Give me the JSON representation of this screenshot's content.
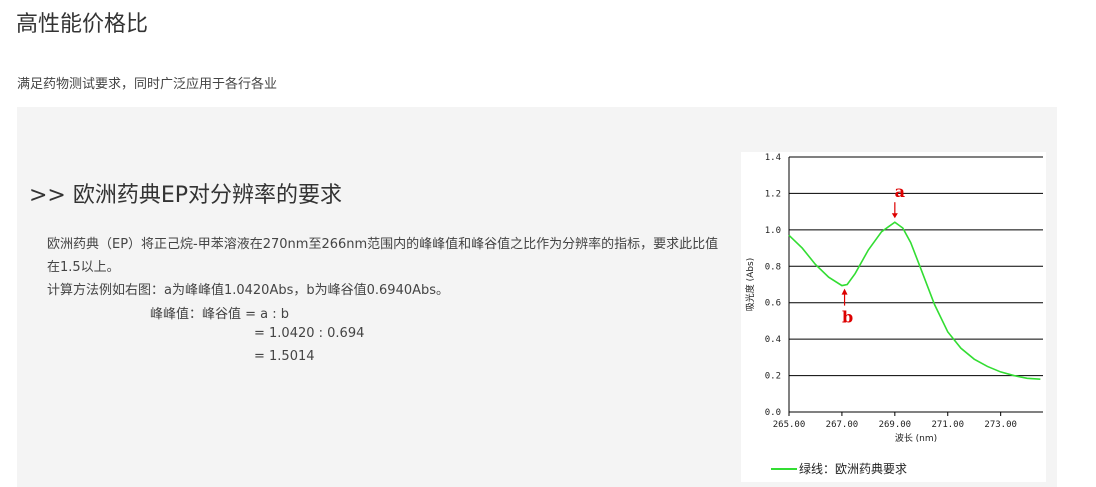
{
  "header": {
    "title": "高性能价格比",
    "subtitle": "满足药物测试要求，同时广泛应用于各行各业"
  },
  "section": {
    "title": ">> 欧洲药典EP对分辨率的要求",
    "para1": "欧洲药典（EP）将正己烷-甲苯溶液在270nm至266nm范围内的峰峰值和峰谷值之比作为分辨率的指标，要求此比值在1.5以上。",
    "para2": "计算方法例如右图：a为峰峰值1.0420Abs，b为峰谷值0.6940Abs。",
    "formula1": "峰峰值：峰谷值 = a : b",
    "formula2": "= 1.0420 : 0.694",
    "formula3": "= 1.5014"
  },
  "chart_data": {
    "type": "line",
    "xlabel": "波长 (nm)",
    "ylabel": "吸光度 (Abs)",
    "xlim": [
      265,
      274.6
    ],
    "ylim": [
      0,
      1.4
    ],
    "x_ticks": [
      "265.00",
      "267.00",
      "269.00",
      "271.00",
      "273.00"
    ],
    "y_ticks": [
      "0.0",
      "0.2",
      "0.4",
      "0.6",
      "0.8",
      "1.0",
      "1.2",
      "1.4"
    ],
    "grid": "horizontal",
    "series": [
      {
        "name": "绿线：欧洲药典要求",
        "color": "#33dd33",
        "x": [
          265.0,
          265.5,
          266.0,
          266.5,
          267.0,
          267.2,
          267.5,
          268.0,
          268.5,
          269.0,
          269.3,
          269.6,
          270.0,
          270.5,
          271.0,
          271.5,
          272.0,
          272.5,
          273.0,
          273.5,
          274.0,
          274.5
        ],
        "y": [
          0.97,
          0.9,
          0.81,
          0.74,
          0.694,
          0.7,
          0.76,
          0.89,
          0.99,
          1.042,
          1.01,
          0.93,
          0.78,
          0.59,
          0.44,
          0.35,
          0.29,
          0.25,
          0.22,
          0.2,
          0.185,
          0.18
        ]
      }
    ],
    "annotations": [
      {
        "label": "a",
        "x": 269.0,
        "y": 1.042,
        "position": "above"
      },
      {
        "label": "b",
        "x": 267.1,
        "y": 0.694,
        "position": "below"
      }
    ]
  }
}
